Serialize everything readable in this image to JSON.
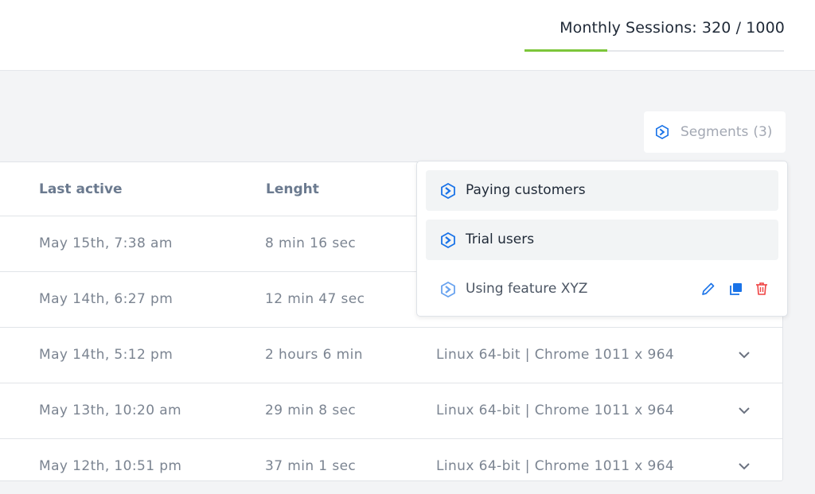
{
  "header": {
    "usage_label": "Monthly Sessions: 320 / 1000",
    "sessions_used": 320,
    "sessions_limit": 1000,
    "progress_color": "#7cc63a"
  },
  "segments": {
    "button_label": "Segments",
    "count_label": "(3)",
    "icon": "segment-hexagon-icon",
    "items": [
      {
        "label": "Paying customers"
      },
      {
        "label": "Trial users"
      },
      {
        "label": "Using feature XYZ"
      }
    ]
  },
  "table": {
    "headers": {
      "last_active": "Last active",
      "length": "Lenght"
    },
    "rows": [
      {
        "last_active": "May 15th, 7:38 am",
        "length": "8 min 16 sec",
        "device": ""
      },
      {
        "last_active": "May 14th, 6:27 pm",
        "length": "12 min 47 sec",
        "device": ""
      },
      {
        "last_active": "May 14th, 5:12 pm",
        "length": "2 hours 6 min",
        "device": "Linux 64-bit | Chrome 1011 x 964"
      },
      {
        "last_active": "May 13th, 10:20 am",
        "length": "29 min 8 sec",
        "device": "Linux 64-bit | Chrome 1011 x 964"
      },
      {
        "last_active": "May 12th, 10:51 pm",
        "length": "37 min 1 sec",
        "device": "Linux 64-bit | Chrome 1011 x 964"
      }
    ]
  },
  "colors": {
    "accent_blue": "#1a73e8",
    "delete_red": "#ef4444",
    "progress_green": "#7cc63a"
  }
}
